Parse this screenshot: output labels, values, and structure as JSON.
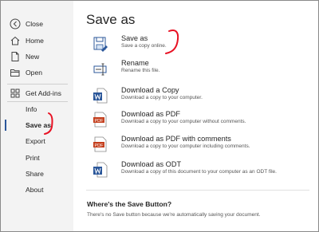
{
  "sidebar": {
    "items": [
      {
        "label": "Close",
        "icon": "back-arrow-icon"
      },
      {
        "label": "Home",
        "icon": "home-icon"
      },
      {
        "label": "New",
        "icon": "new-document-icon"
      },
      {
        "label": "Open",
        "icon": "open-folder-icon"
      },
      {
        "label": "Get Add-ins",
        "icon": "add-ins-grid-icon"
      },
      {
        "label": "Info"
      },
      {
        "label": "Save as",
        "selected": true
      },
      {
        "label": "Export"
      },
      {
        "label": "Print"
      },
      {
        "label": "Share"
      },
      {
        "label": "About"
      }
    ]
  },
  "main": {
    "title": "Save as",
    "options": [
      {
        "title": "Save as",
        "desc": "Save a copy online.",
        "icon": "save-as-icon"
      },
      {
        "title": "Rename",
        "desc": "Rename this file.",
        "icon": "rename-icon"
      },
      {
        "title": "Download a Copy",
        "desc": "Download a copy to your computer.",
        "icon": "word-document-icon"
      },
      {
        "title": "Download as PDF",
        "desc": "Download a copy to your computer without comments.",
        "icon": "pdf-icon"
      },
      {
        "title": "Download as PDF with comments",
        "desc": "Download a copy to your computer including comments.",
        "icon": "pdf-icon"
      },
      {
        "title": "Download as ODT",
        "desc": "Download a copy of this document to your computer as an ODT file.",
        "icon": "word-document-icon"
      }
    ],
    "help_title": "Where's the Save Button?",
    "help_text": "There's no Save button because we're automatically saving your document."
  },
  "colors": {
    "sidebar_bg": "#f3f3f3",
    "accent": "#2b579a",
    "pdf_red": "#c43e1c",
    "annotation_red": "#e81123"
  }
}
